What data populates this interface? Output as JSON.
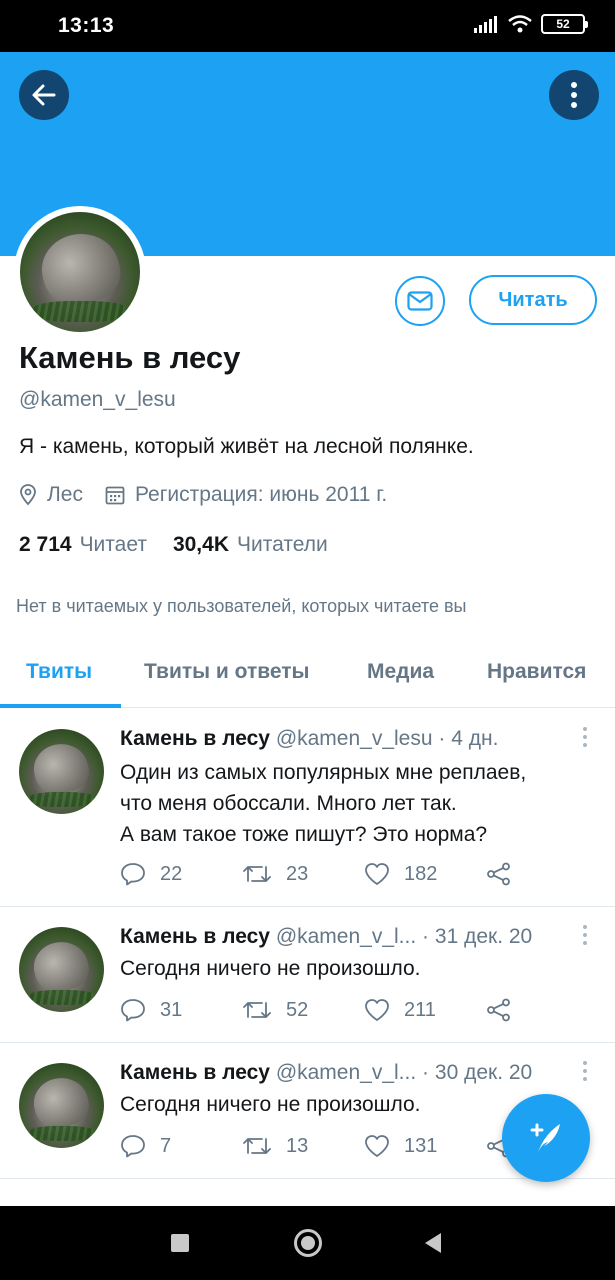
{
  "status_bar": {
    "time": "13:13",
    "battery": "52"
  },
  "profile": {
    "display_name": "Камень в лесу",
    "handle": "@kamen_v_lesu",
    "bio": "Я - камень, который живёт на лесной полянке.",
    "location": "Лес",
    "joined": "Регистрация: июнь 2011 г.",
    "following_count": "2 714",
    "following_label": "Читает",
    "followers_count": "30,4K",
    "followers_label": "Читатели",
    "no_mutual": "Нет в читаемых у пользователей, которых читаете вы",
    "follow_button": "Читать"
  },
  "tabs": [
    {
      "label": "Твиты",
      "active": true
    },
    {
      "label": "Твиты и ответы",
      "active": false
    },
    {
      "label": "Медиа",
      "active": false
    },
    {
      "label": "Нравится",
      "active": false
    }
  ],
  "tweets": [
    {
      "name": "Камень в лесу",
      "handle": "@kamen_v_lesu",
      "sep": "·",
      "date": "4 дн.",
      "lines": [
        "Один из самых популярных мне реплаев,",
        "что меня обоссали. Много лет так.",
        "А вам такое тоже пишут? Это норма?"
      ],
      "replies": "22",
      "retweets": "23",
      "likes": "182"
    },
    {
      "name": "Камень в лесу",
      "handle": "@kamen_v_l...",
      "sep": "·",
      "date": "31 дек. 20",
      "lines": [
        "Сегодня ничего не произошло."
      ],
      "replies": "31",
      "retweets": "52",
      "likes": "211"
    },
    {
      "name": "Камень в лесу",
      "handle": "@kamen_v_l...",
      "sep": "·",
      "date": "30 дек. 20",
      "lines": [
        "Сегодня ничего не произошло."
      ],
      "replies": "7",
      "retweets": "13",
      "likes": "131"
    }
  ],
  "colors": {
    "accent": "#1da1f2",
    "muted": "#657786",
    "text": "#14171a"
  },
  "icons": [
    "back-arrow-icon",
    "more-vertical-icon",
    "mail-icon",
    "location-icon",
    "calendar-icon",
    "reply-icon",
    "retweet-icon",
    "like-icon",
    "share-icon",
    "compose-icon"
  ]
}
